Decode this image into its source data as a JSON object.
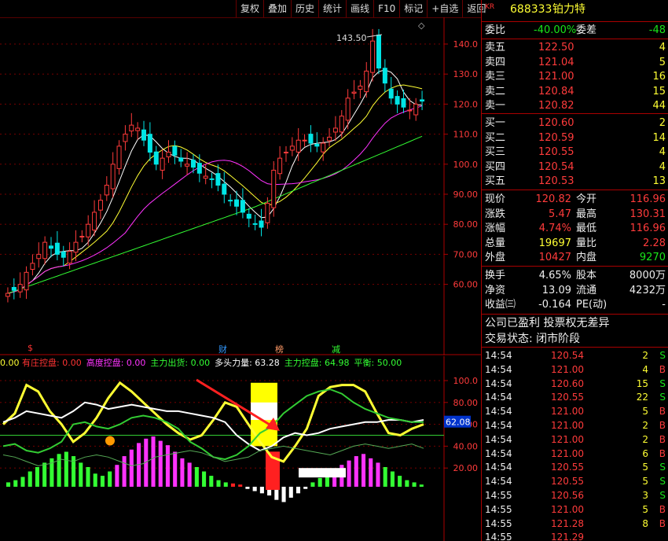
{
  "toolbar": {
    "items": [
      "复权",
      "叠加",
      "历史",
      "统计",
      "画线",
      "F10",
      "标记",
      "+自选",
      "返回"
    ]
  },
  "stock": {
    "market": "KR",
    "code": "688333",
    "name": "铂力特"
  },
  "price_axis": [
    140.0,
    130.0,
    120.0,
    110.0,
    100.0,
    90.0,
    80.0,
    70.0,
    60.0
  ],
  "indicator_axis": [
    "100.0",
    "80.00",
    "60.00",
    "40.00",
    "20.00"
  ],
  "indicator_marker": "62.08",
  "kline_annotation": "143.50",
  "event_markers": {
    "dollar": "$",
    "cai": "财",
    "bang": "榜",
    "jian": "减"
  },
  "indicator_header": {
    "lead": "0.00",
    "items": [
      {
        "label": "有庄控盘:",
        "value": "0.00",
        "color": "#ff3333"
      },
      {
        "label": "高度控盘:",
        "value": "0.00",
        "color": "#ff33ff"
      },
      {
        "label": "主力出货:",
        "value": "0.00",
        "color": "#33ff33"
      },
      {
        "label": "多头力量:",
        "value": "63.28",
        "color": "#ffffff"
      },
      {
        "label": "主力控盘:",
        "value": "64.98",
        "color": "#33ff33"
      },
      {
        "label": "平衡:",
        "value": "50.00",
        "color": "#33ff33"
      }
    ]
  },
  "commission": {
    "label1": "委比",
    "value1": "-40.00%",
    "label2": "委差",
    "value2": "-48"
  },
  "asks": [
    {
      "label": "卖五",
      "price": "122.50",
      "vol": "4"
    },
    {
      "label": "卖四",
      "price": "121.04",
      "vol": "5"
    },
    {
      "label": "卖三",
      "price": "121.00",
      "vol": "16"
    },
    {
      "label": "卖二",
      "price": "120.84",
      "vol": "15"
    },
    {
      "label": "卖一",
      "price": "120.82",
      "vol": "44"
    }
  ],
  "bids": [
    {
      "label": "买一",
      "price": "120.60",
      "vol": "2"
    },
    {
      "label": "买二",
      "price": "120.59",
      "vol": "14"
    },
    {
      "label": "买三",
      "price": "120.55",
      "vol": "4"
    },
    {
      "label": "买四",
      "price": "120.54",
      "vol": "4"
    },
    {
      "label": "买五",
      "price": "120.53",
      "vol": "13"
    }
  ],
  "stats": [
    {
      "l1": "现价",
      "v1": "120.82",
      "c1": "red",
      "l2": "今开",
      "v2": "116.96",
      "c2": "red"
    },
    {
      "l1": "涨跌",
      "v1": "5.47",
      "c1": "red",
      "l2": "最高",
      "v2": "130.31",
      "c2": "red"
    },
    {
      "l1": "涨幅",
      "v1": "4.74%",
      "c1": "red",
      "l2": "最低",
      "v2": "116.96",
      "c2": "red"
    },
    {
      "l1": "总量",
      "v1": "19697",
      "c1": "yellow",
      "l2": "量比",
      "v2": "2.28",
      "c2": "red"
    },
    {
      "l1": "外盘",
      "v1": "10427",
      "c1": "red",
      "l2": "内盘",
      "v2": "9270",
      "c2": "green"
    }
  ],
  "stats2": [
    {
      "l1": "换手",
      "v1": "4.65%",
      "l2": "股本",
      "v2": "8000万"
    },
    {
      "l1": "净资",
      "v1": "13.09",
      "l2": "流通",
      "v2": "4232万"
    },
    {
      "l1": "收益㈢",
      "v1": "-0.164",
      "l2": "PE(动)",
      "v2": "-"
    }
  ],
  "info_lines": [
    "公司已盈利 投票权无差异",
    "交易状态: 闭市阶段"
  ],
  "ticks": [
    {
      "time": "14:54",
      "price": "120.54",
      "vol": "2",
      "side": "S"
    },
    {
      "time": "14:54",
      "price": "121.00",
      "vol": "4",
      "side": "B"
    },
    {
      "time": "14:54",
      "price": "120.60",
      "vol": "15",
      "side": "S"
    },
    {
      "time": "14:54",
      "price": "120.55",
      "vol": "22",
      "side": "S"
    },
    {
      "time": "14:54",
      "price": "121.00",
      "vol": "5",
      "side": "B"
    },
    {
      "time": "14:54",
      "price": "121.00",
      "vol": "2",
      "side": "B"
    },
    {
      "time": "14:54",
      "price": "121.00",
      "vol": "2",
      "side": "B"
    },
    {
      "time": "14:54",
      "price": "121.00",
      "vol": "6",
      "side": "B"
    },
    {
      "time": "14:54",
      "price": "120.55",
      "vol": "5",
      "side": "S"
    },
    {
      "time": "14:54",
      "price": "120.55",
      "vol": "5",
      "side": "S"
    },
    {
      "time": "14:55",
      "price": "120.56",
      "vol": "3",
      "side": "S"
    },
    {
      "time": "14:55",
      "price": "121.00",
      "vol": "5",
      "side": "B"
    },
    {
      "time": "14:55",
      "price": "121.28",
      "vol": "8",
      "side": "B"
    },
    {
      "time": "14:55",
      "price": "121.29",
      "vol": "",
      "side": ""
    }
  ],
  "colors": {
    "up": "#ff3b3b",
    "down": "#00e5e5",
    "ma5": "#ffffff",
    "ma10": "#ffff33",
    "ma20": "#ff33ff",
    "ma60": "#33ff33",
    "border": "#aa0000"
  }
}
